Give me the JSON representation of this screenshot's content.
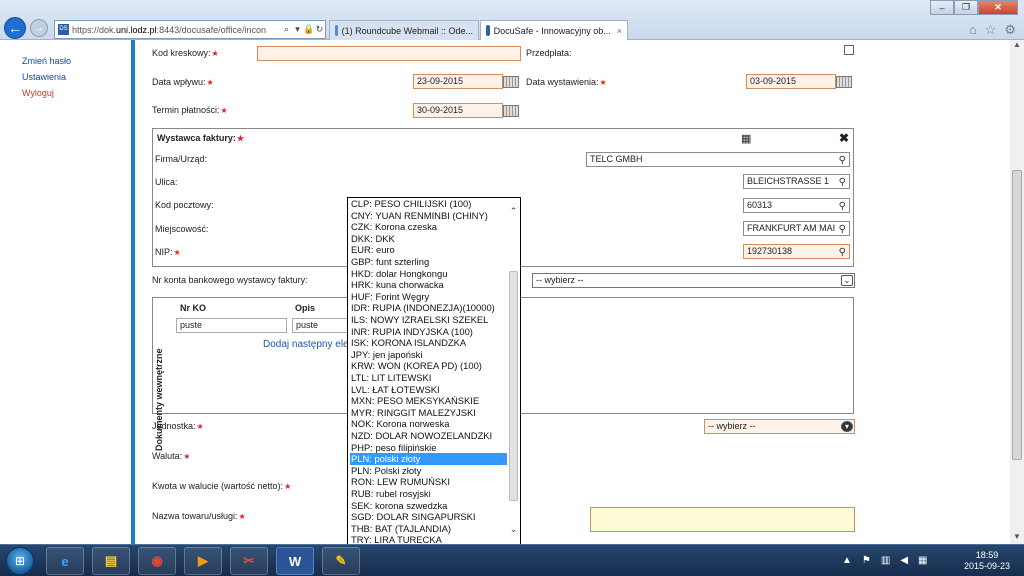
{
  "browser": {
    "url_prefix": "https://dok.",
    "url_domain": "uni.lodz.pl",
    "url_rest": ":8443/docusafe/office/incon",
    "tabs": [
      {
        "label": "(1) Roundcube Webmail :: Ode..."
      },
      {
        "label": "DocuSafe - Innowacyjny ob..."
      }
    ],
    "tab_close_label": "×"
  },
  "sidebar": {
    "links": [
      {
        "label": "Zmień hasło",
        "color": "#1a44a8"
      },
      {
        "label": "Ustawienia",
        "color": "#1a44a8"
      },
      {
        "label": "Wyloguj",
        "color": "#c0392b"
      }
    ]
  },
  "form": {
    "kod_kreskowy": {
      "label": "Kod kreskowy:",
      "value": ""
    },
    "przedplata": {
      "label": "Przedpłata:",
      "checked": false
    },
    "data_wplywu": {
      "label": "Data wpływu:",
      "value": "23-09-2015"
    },
    "data_wystawienia": {
      "label": "Data wystawienia:",
      "value": "03-09-2015"
    },
    "termin_platnosci": {
      "label": "Termin płatności:",
      "value": "30-09-2015"
    },
    "required_marker": "★",
    "wystawca": {
      "title": "Wystawca faktury:",
      "firma": {
        "label": "Firma/Urząd:",
        "value": "TELC GMBH"
      },
      "ulica": {
        "label": "Ulica:",
        "value": "BLEICHSTRASSE 1"
      },
      "kod": {
        "label": "Kod pocztowy:",
        "value": "60313"
      },
      "miejscowosc": {
        "label": "Miejscowość:",
        "value": "FRANKFURT AM MAI"
      },
      "nip": {
        "label": "NIP:",
        "value": "192730138"
      }
    },
    "nr_konta": {
      "label": "Nr konta bankowego wystawcy faktury:",
      "value": "-- wybierz --"
    },
    "dokumenty": {
      "side_label": "Dokumenty wewnętrzne",
      "col_nr": "Nr KO",
      "col_opis": "Opis",
      "nr_value": "puste",
      "opis_value": "puste",
      "add_link": "Dodaj następny ele"
    },
    "jednostka": {
      "label": "Jednostka:",
      "value": "-- wybierz --"
    },
    "waluta": {
      "label": "Waluta:"
    },
    "kwota": {
      "label": "Kwota w walucie (wartość netto):"
    },
    "nazwa_towaru": {
      "label": "Nazwa towaru/usługi:"
    }
  },
  "currency_dropdown": {
    "selected_index": 22,
    "options": [
      "CLP: PESO CHILIJSKI (100)",
      "CNY: YUAN RENMINBI (CHINY)",
      "CZK: Korona czeska",
      "DKK: DKK",
      "EUR: euro",
      "GBP: funt szterling",
      "HKD: dolar Hongkongu",
      "HRK: kuna chorwacka",
      "HUF: Forint Węgry",
      "IDR: RUPIA (INDONEZJA)(10000)",
      "ILS: NOWY IZRAELSKI SZEKEL",
      "INR: RUPIA INDYJSKA (100)",
      "ISK: KORONA ISLANDZKA",
      "JPY: jen japoński",
      "KRW: WON (KOREA PD) (100)",
      "LTL: LIT LITEWSKI",
      "LVL: ŁAT ŁOTEWSKI",
      "MXN: PESO MEKSYKAŃSKIE",
      "MYR: RINGGIT MALEZYJSKI",
      "NOK: Korona norweska",
      "NZD: DOLAR NOWOZELANDZKI",
      "PHP: peso filipińskie",
      "PLN: polski złoty",
      "PLN: Polski złoty",
      "RON: LEW RUMUŃSKI",
      "RUB: rubel rosyjski",
      "SEK: korona szwedzka",
      "SGD: DOLAR SINGAPURSKI",
      "THB: BAT (TAJLANDIA)",
      "TRY: LIRA TURECKA"
    ]
  },
  "taskbar": {
    "time": "18:59",
    "date": "2015-09-23"
  }
}
